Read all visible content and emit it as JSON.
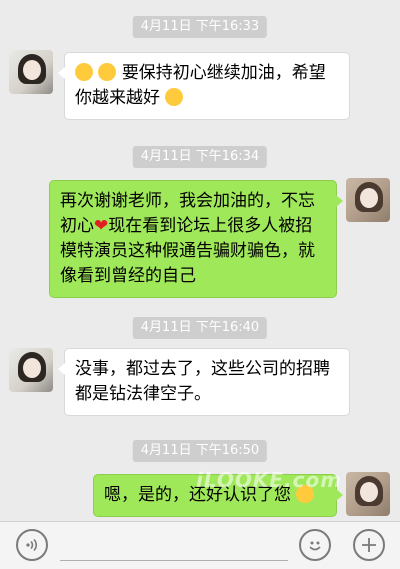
{
  "messages": [
    {
      "time": "4月11日 下午16:33",
      "side": "left",
      "parts": [
        "",
        "",
        "要保持初心继续加油，希望",
        "你越来越好"
      ]
    },
    {
      "time": "4月11日 下午16:34",
      "side": "right",
      "lines": [
        "再次谢谢老师，我会加油的，不忘",
        "初心",
        "现在看到论坛上很多人被招",
        "模特演员这种假通告骗财骗色，就",
        "像看到曾经的自己"
      ]
    },
    {
      "time": "4月11日 下午16:40",
      "side": "left",
      "lines": [
        "没事，都过去了，这些公司的招聘",
        "都是钻法律空子。"
      ]
    },
    {
      "time": "4月11日 下午16:50",
      "side": "right",
      "lines": [
        "嗯，是的，还好认识了您"
      ]
    }
  ],
  "watermark": "iLOOKE.com",
  "toolbar": {
    "voice_icon": "voice-icon",
    "emoji_icon": "emoji-icon",
    "plus_icon": "plus-icon"
  }
}
